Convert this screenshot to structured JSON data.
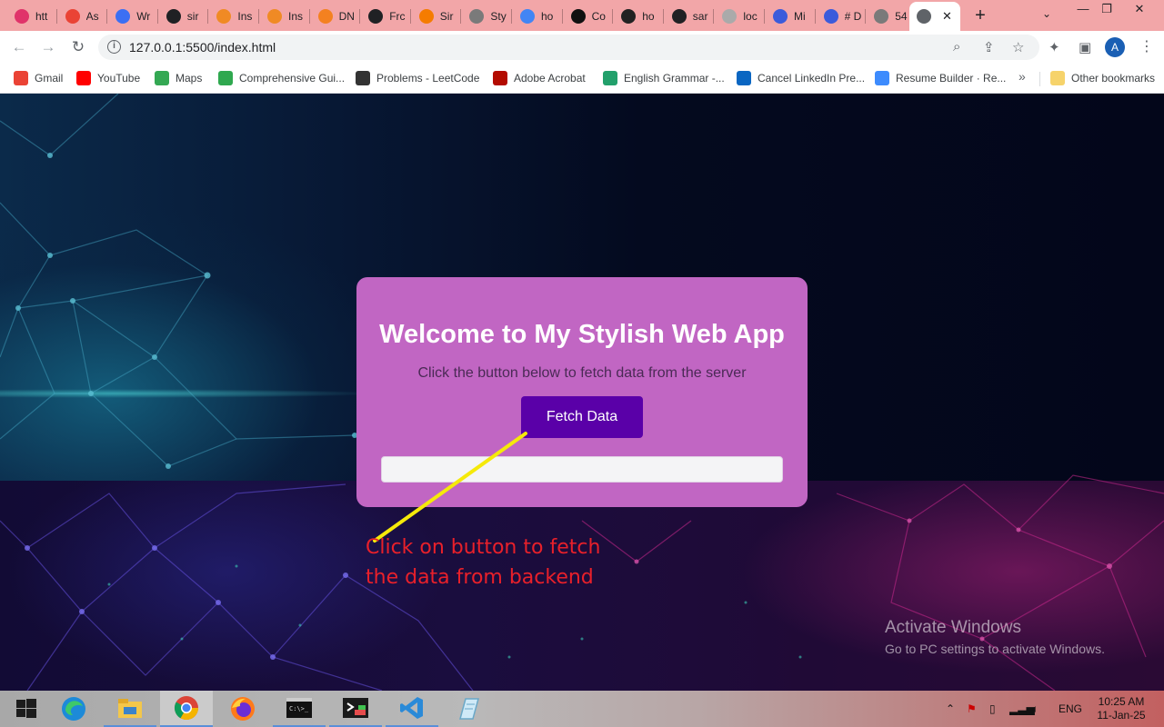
{
  "browser": {
    "tabs": [
      {
        "label": "htt",
        "icon": "pink-pen-icon",
        "color": "#e0336a"
      },
      {
        "label": "As",
        "icon": "gmail-icon",
        "color": "#ea4335"
      },
      {
        "label": "Wr",
        "icon": "diamond-icon",
        "color": "#3b6ff3"
      },
      {
        "label": "sir",
        "icon": "github-icon",
        "color": "#202124"
      },
      {
        "label": "Ins",
        "icon": "orange-squares-icon",
        "color": "#f08a24"
      },
      {
        "label": "Ins",
        "icon": "orange-squares-icon",
        "color": "#f08a24"
      },
      {
        "label": "DN",
        "icon": "cloudflare-icon",
        "color": "#f48120"
      },
      {
        "label": "Frc",
        "icon": "chatgpt-icon",
        "color": "#202124"
      },
      {
        "label": "Sir",
        "icon": "flame-icon",
        "color": "#f57c00"
      },
      {
        "label": "Sty",
        "icon": "globe-icon",
        "color": "#7a7a7a"
      },
      {
        "label": "ho",
        "icon": "google-icon",
        "color": "#4285f4"
      },
      {
        "label": "Co",
        "icon": "ab-icon",
        "color": "#111111"
      },
      {
        "label": "ho",
        "icon": "dark-circle-icon",
        "color": "#222222"
      },
      {
        "label": "sar",
        "icon": "github-icon",
        "color": "#202124"
      },
      {
        "label": "loc",
        "icon": "globe-icon",
        "color": "#aaaaaa"
      },
      {
        "label": "Mi",
        "icon": "calendar-icon",
        "color": "#3b5bdb"
      },
      {
        "label": "# D",
        "icon": "calendar-icon",
        "color": "#3b5bdb"
      },
      {
        "label": "54",
        "icon": "globe-icon",
        "color": "#7a7a7a"
      }
    ],
    "active_tab": {
      "icon": "globe-icon",
      "close": "✕"
    },
    "new_tab": "+",
    "url": "127.0.0.1:5500/index.html",
    "avatar_letter": "A",
    "bookmarks": [
      {
        "label": "Gmail",
        "icon": "gmail-icon",
        "color": "#ea4335"
      },
      {
        "label": "YouTube",
        "icon": "youtube-icon",
        "color": "#ff0000"
      },
      {
        "label": "Maps",
        "icon": "maps-pin-icon",
        "color": "#34a853"
      },
      {
        "label": "Comprehensive Gui...",
        "icon": "bolt-icon",
        "color": "#2fa84f"
      },
      {
        "label": "Problems - LeetCode",
        "icon": "leetcode-icon",
        "color": "#333333"
      },
      {
        "label": "Adobe Acrobat",
        "icon": "acrobat-icon",
        "color": "#b30b00"
      },
      {
        "label": "English Grammar -...",
        "icon": "grammar-icon",
        "color": "#22a06b"
      },
      {
        "label": "Cancel LinkedIn Pre...",
        "icon": "linkedin-icon",
        "color": "#0a66c2"
      },
      {
        "label": "Resume Builder · Re...",
        "icon": "resume-icon",
        "color": "#3d8bfd"
      }
    ],
    "more": "»",
    "other_bookmarks": "Other bookmarks"
  },
  "page": {
    "title": "Welcome to My Stylish Web App",
    "subtitle": "Click the button below to fetch data from the server",
    "button_label": "Fetch Data",
    "annotation": {
      "line1": "Click on button to fetch",
      "line2": "the data from backend",
      "color": "#e8202a"
    },
    "watermark": {
      "title": "Activate Windows",
      "subtitle": "Go to PC settings to activate Windows."
    },
    "colors": {
      "card": "#c166c3",
      "button": "#5a00a8",
      "arrow": "#f5e90a"
    }
  },
  "taskbar": {
    "apps": [
      "start-icon",
      "edge-icon",
      "file-explorer-icon",
      "chrome-icon",
      "firefox-icon",
      "terminal-icon",
      "devtool-icon",
      "vscode-icon",
      "notepad-icon"
    ],
    "language": "ENG",
    "time": "10:25 AM",
    "date": "11-Jan-25"
  }
}
